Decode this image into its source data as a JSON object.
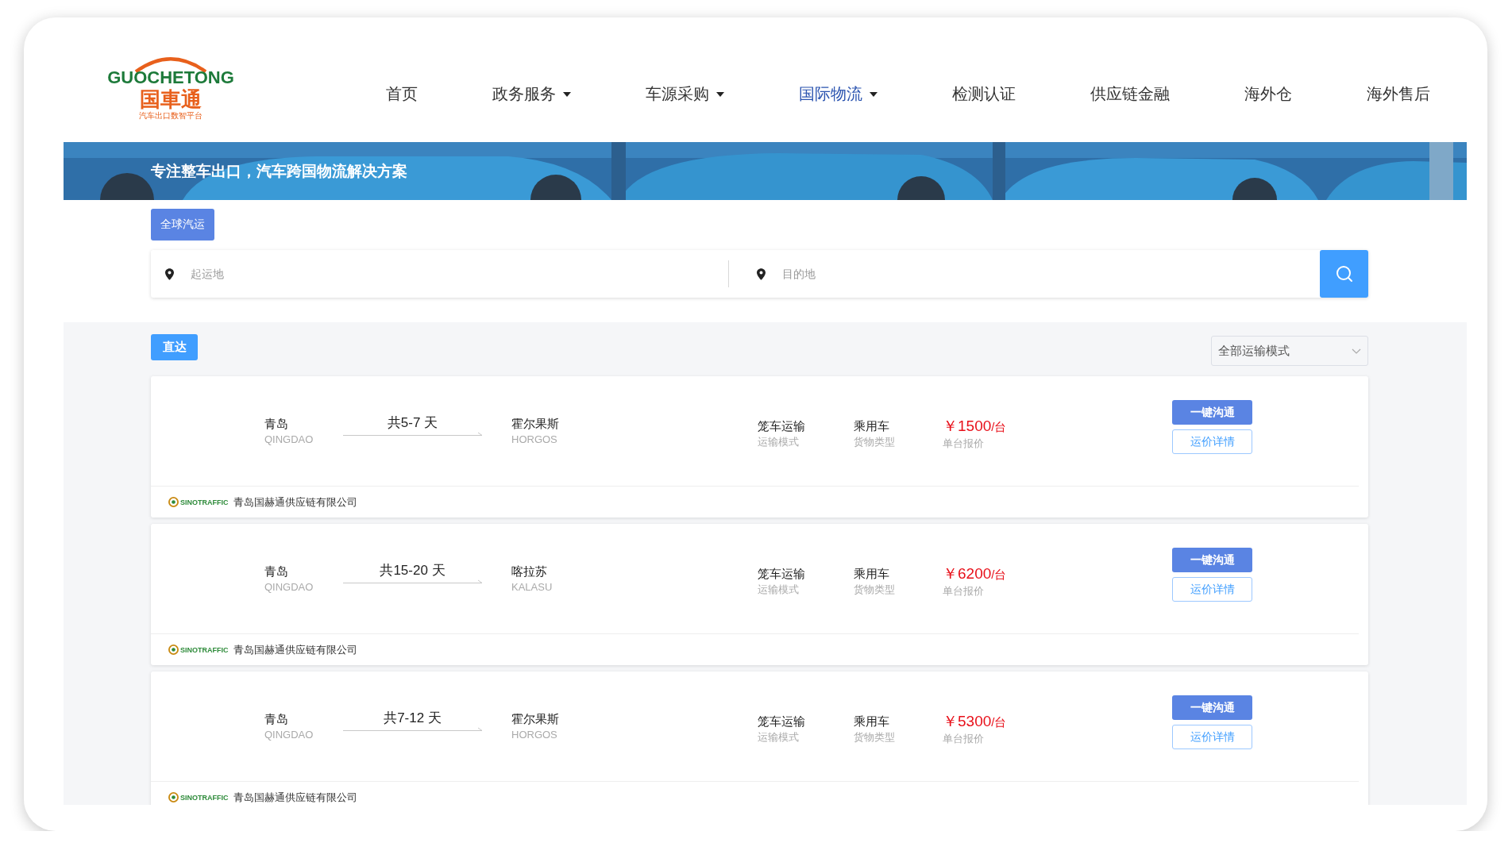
{
  "logo": {
    "name": "GUOCHETONG",
    "chinese": "国車通",
    "tagline": "汽车出口数智平台"
  },
  "nav": [
    {
      "label": "首页",
      "selected": false,
      "dropdown": false
    },
    {
      "label": "政务服务",
      "selected": false,
      "dropdown": true
    },
    {
      "label": "车源采购",
      "selected": false,
      "dropdown": true
    },
    {
      "label": "国际物流",
      "selected": true,
      "dropdown": true
    },
    {
      "label": "检测认证",
      "selected": false,
      "dropdown": false
    },
    {
      "label": "供应链金融",
      "selected": false,
      "dropdown": false
    },
    {
      "label": "海外仓",
      "selected": false,
      "dropdown": false
    },
    {
      "label": "海外售后",
      "selected": false,
      "dropdown": false
    }
  ],
  "banner": {
    "kind": "picture",
    "headline": "专注整车出口，汽车跨国物流解决方案"
  },
  "search_tabs": [
    {
      "label": "全球汽运",
      "selected": true
    }
  ],
  "search": {
    "origin_placeholder": "起运地",
    "destination_placeholder": "目的地"
  },
  "filters": {
    "route_tabs": [
      {
        "label": "直达",
        "selected": true
      }
    ],
    "mode_select": "全部运输模式"
  },
  "routes": [
    {
      "origin": "青岛",
      "origin_en": "QINGDAO",
      "duration": "共5-7 天",
      "destination": "霍尔果斯",
      "destination_en": "HORGOS",
      "mode": "笼车运输",
      "mode_label": "运输模式",
      "cargo": "乘用车",
      "cargo_label": "货物类型",
      "price": "￥1500",
      "unit": "/台",
      "price_label": "单台报价",
      "contact_button": "一键沟通",
      "details_button": "运价详情",
      "company_logo": "SINOTRAFFIC",
      "company": "青岛国赫通供应链有限公司"
    },
    {
      "origin": "青岛",
      "origin_en": "QINGDAO",
      "duration": "共15-20 天",
      "destination": "喀拉苏",
      "destination_en": "KALASU",
      "mode": "笼车运输",
      "mode_label": "运输模式",
      "cargo": "乘用车",
      "cargo_label": "货物类型",
      "price": "￥6200",
      "unit": "/台",
      "price_label": "单台报价",
      "contact_button": "一键沟通",
      "details_button": "运价详情",
      "company_logo": "SINOTRAFFIC",
      "company": "青岛国赫通供应链有限公司"
    },
    {
      "origin": "青岛",
      "origin_en": "QINGDAO",
      "duration": "共7-12 天",
      "destination": "霍尔果斯",
      "destination_en": "HORGOS",
      "mode": "笼车运输",
      "mode_label": "运输模式",
      "cargo": "乘用车",
      "cargo_label": "货物类型",
      "price": "￥5300",
      "unit": "/台",
      "price_label": "单台报价",
      "contact_button": "一键沟通",
      "details_button": "运价详情",
      "company_logo": "SINOTRAFFIC",
      "company": "青岛国赫通供应链有限公司"
    }
  ]
}
